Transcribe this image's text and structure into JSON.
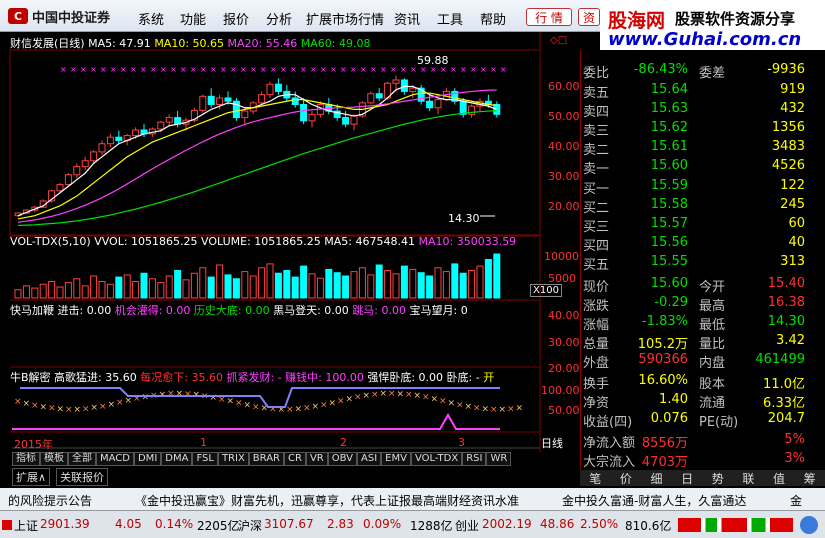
{
  "app": {
    "logo_text": "中国中投证券"
  },
  "menu": [
    "系统",
    "功能",
    "报价",
    "分析",
    "扩展市场行情",
    "资讯",
    "工具",
    "帮助"
  ],
  "quick_buttons": [
    "行 情",
    "资"
  ],
  "banner": {
    "site_cn": "股海网",
    "slogan": "股票软件资源分享",
    "url": "www.Guhai.com.cn"
  },
  "main_chart": {
    "header": {
      "name": "财信发展(日线)",
      "ma5": "MA5: 47.91",
      "ma10": "MA10: 50.65",
      "ma20": "MA20: 55.46",
      "ma60": "MA60: 49.08"
    },
    "high_label": "59.88",
    "low_label": "14.30",
    "y_ticks": [
      "60.00",
      "50.00",
      "40.00",
      "30.00",
      "20.00"
    ],
    "candles": [
      [
        17,
        18,
        16.5,
        17.8
      ],
      [
        17.8,
        19,
        17.5,
        18.7
      ],
      [
        18.7,
        20,
        18,
        19.6
      ],
      [
        19.6,
        22,
        19.3,
        21.5
      ],
      [
        21.5,
        25,
        21,
        24.6
      ],
      [
        24.6,
        27,
        24,
        26.5
      ],
      [
        26.5,
        30,
        26,
        29.5
      ],
      [
        29.5,
        33,
        28.5,
        32
      ],
      [
        32,
        35,
        31,
        33.8
      ],
      [
        33.8,
        37,
        33,
        36.5
      ],
      [
        36.5,
        40,
        35.5,
        39
      ],
      [
        39,
        42,
        38,
        41
      ],
      [
        41,
        43,
        39,
        40
      ],
      [
        40,
        42,
        38.5,
        41.5
      ],
      [
        41.5,
        44,
        40.5,
        43.2
      ],
      [
        43.2,
        45,
        41,
        42
      ],
      [
        42,
        44,
        41,
        43.5
      ],
      [
        43.5,
        46,
        42.5,
        45.6
      ],
      [
        45.6,
        48,
        44.5,
        47
      ],
      [
        47,
        49,
        44,
        45
      ],
      [
        45,
        47,
        43,
        46.2
      ],
      [
        46.2,
        50,
        45.5,
        49.2
      ],
      [
        49.2,
        54,
        48.5,
        53.5
      ],
      [
        53.5,
        56,
        50,
        51
      ],
      [
        51,
        54,
        49.5,
        53
      ],
      [
        53,
        55,
        51,
        52
      ],
      [
        52,
        53,
        46,
        47
      ],
      [
        47,
        50,
        45,
        49
      ],
      [
        49,
        52,
        48,
        51.5
      ],
      [
        51.5,
        55,
        51,
        54
      ],
      [
        54,
        58,
        53,
        57.2
      ],
      [
        57.2,
        59,
        54,
        55
      ],
      [
        55,
        57,
        52,
        53
      ],
      [
        53,
        55,
        50,
        51
      ],
      [
        51,
        53,
        45,
        46
      ],
      [
        46,
        49,
        44,
        48
      ],
      [
        48,
        52,
        47,
        51
      ],
      [
        51,
        53,
        48,
        49
      ],
      [
        49,
        51,
        46,
        47
      ],
      [
        47,
        49,
        44,
        45
      ],
      [
        45,
        48,
        43,
        47.5
      ],
      [
        47.5,
        52,
        47,
        51.5
      ],
      [
        51.5,
        55,
        51,
        54.3
      ],
      [
        54.3,
        56,
        52,
        53
      ],
      [
        53,
        58,
        52.5,
        57.5
      ],
      [
        57.5,
        59.88,
        55,
        58.5
      ],
      [
        58.5,
        59,
        54,
        55
      ],
      [
        55,
        57,
        53,
        56
      ],
      [
        56,
        57,
        51,
        52
      ],
      [
        52,
        54,
        49,
        50
      ],
      [
        50,
        53,
        48,
        52.5
      ],
      [
        52.5,
        56,
        52,
        55
      ],
      [
        55,
        56,
        51,
        52
      ],
      [
        52,
        53,
        47,
        48
      ],
      [
        48,
        51,
        47,
        50.5
      ],
      [
        50.5,
        53,
        49,
        52
      ],
      [
        52,
        54,
        50,
        51
      ],
      [
        51,
        52,
        47,
        48
      ]
    ],
    "ma5": [
      17,
      18,
      19,
      20,
      22,
      24,
      26,
      28,
      30,
      33,
      35,
      37,
      39,
      40,
      41,
      42,
      42.5,
      43,
      44.5,
      45,
      45.5,
      46.5,
      48,
      49.5,
      50.5,
      51.5,
      51,
      50,
      50,
      51,
      52,
      53.5,
      54,
      54,
      52.5,
      51,
      50,
      49,
      48.5,
      48,
      47.5,
      48,
      49.5,
      51,
      53,
      55.5,
      56.5,
      56.5,
      55.5,
      54,
      53,
      52.5,
      52.5,
      52,
      51.5,
      51,
      50.5,
      49.5
    ],
    "ma10": [
      16,
      16.5,
      17,
      18,
      19,
      20,
      21.5,
      23,
      25,
      27,
      29,
      31,
      33,
      35,
      36.5,
      38,
      39.5,
      40.5,
      41.5,
      42.5,
      43.5,
      44.5,
      45.5,
      46.5,
      47.5,
      48.5,
      49,
      49.5,
      50,
      50.5,
      51,
      51.5,
      52,
      52.5,
      52.5,
      52,
      51.5,
      51,
      50.5,
      50,
      49.5,
      49.5,
      50,
      50.5,
      51,
      52,
      53,
      54,
      54.5,
      54.5,
      54,
      53.5,
      53,
      52.5,
      52,
      51.5,
      51,
      50.7
    ],
    "ma20": [
      15,
      15.3,
      15.7,
      16.2,
      16.8,
      17.5,
      18.3,
      19.2,
      20.2,
      21.3,
      22.5,
      23.8,
      25.2,
      26.7,
      28.2,
      29.8,
      31.3,
      32.8,
      34.2,
      35.6,
      37,
      38.3,
      39.6,
      40.8,
      42,
      43,
      44,
      44.9,
      45.7,
      46.4,
      47,
      47.6,
      48.2,
      48.7,
      49.1,
      49.4,
      49.6,
      49.8,
      50,
      50.1,
      50.2,
      50.4,
      50.6,
      50.9,
      51.2,
      51.6,
      52,
      52.4,
      52.8,
      53.2,
      53.6,
      54,
      54.4,
      54.7,
      55,
      55.2,
      55.4,
      55.46
    ],
    "ma60": [
      14,
      14.1,
      14.2,
      14.4,
      14.6,
      14.8,
      15.1,
      15.4,
      15.8,
      16.2,
      16.7,
      17.2,
      17.8,
      18.4,
      19,
      19.7,
      20.4,
      21.1,
      21.9,
      22.7,
      23.5,
      24.3,
      25.2,
      26.1,
      27,
      27.9,
      28.8,
      29.7,
      30.6,
      31.5,
      32.4,
      33.3,
      34.2,
      35.1,
      36,
      36.8,
      37.6,
      38.4,
      39.2,
      40,
      40.8,
      41.5,
      42.2,
      42.9,
      43.6,
      44.3,
      45,
      45.6,
      46.2,
      46.7,
      47.2,
      47.6,
      48,
      48.3,
      48.6,
      48.8,
      49,
      49.08
    ]
  },
  "vol_panel": {
    "header": {
      "name": "VOL-TDX(5,10)",
      "vvol": "VVOL: 1051865.25",
      "volume": "VOLUME: 1051865.25",
      "ma5": "MA5: 467548.41",
      "ma10": "MA10: 350033.59"
    },
    "y_ticks": [
      "10000",
      "5000"
    ],
    "unit": "X100",
    "bars": [
      15,
      22,
      18,
      25,
      30,
      20,
      28,
      35,
      22,
      40,
      30,
      25,
      38,
      42,
      30,
      45,
      35,
      28,
      40,
      50,
      33,
      45,
      55,
      38,
      60,
      42,
      35,
      48,
      40,
      55,
      62,
      45,
      50,
      38,
      58,
      44,
      36,
      52,
      46,
      40,
      48,
      55,
      42,
      60,
      50,
      44,
      58,
      52,
      46,
      40,
      55,
      48,
      62,
      45,
      50,
      58,
      70,
      1051
    ]
  },
  "ind_panel": {
    "header": {
      "name": "快马加鞭",
      "chi": "进击: 0.00",
      "jihui": "机会灌得: 0.00",
      "lishi": "历史大底: 0.00",
      "heima": "黑马登天: 0.00",
      "tiaoma": "跳马: 0.00",
      "baoma": "宝马望月: 0"
    },
    "y_ticks": [
      "40.00",
      "30.00",
      "20.00"
    ]
  },
  "ind2_panel": {
    "header": {
      "name": "牛B解密",
      "gaoge": "高歌猛进: 35.60",
      "meikuang": "每况愈下: 35.60",
      "zhuajin": "抓紧发财: -",
      "zhuanqian": "赚钱中: 100.00",
      "qianghan": "强悍卧底: 0.00",
      "wodi": "卧底: -",
      "kai": "开"
    },
    "y_ticks": [
      "100.00",
      "50.00"
    ]
  },
  "time_axis": {
    "year": "2015年",
    "marks": [
      "1",
      "2",
      "3"
    ],
    "period": "日线"
  },
  "bottom_tabs": [
    "指标",
    "模板",
    "全部",
    "MACD",
    "DMI",
    "DMA",
    "FSL",
    "TRIX",
    "BRAR",
    "CR",
    "VR",
    "OBV",
    "ASI",
    "EMV",
    "VOL-TDX",
    "RSI",
    "WR"
  ],
  "bottom_tabs2": [
    "扩展∧",
    "关联报价"
  ],
  "quotes": {
    "weibi": {
      "k": "委比",
      "v": "-86.43%",
      "k2": "委差",
      "v2": "-9936"
    },
    "sell": [
      {
        "k": "卖五",
        "p": "15.64",
        "v": "919"
      },
      {
        "k": "卖四",
        "p": "15.63",
        "v": "432"
      },
      {
        "k": "卖三",
        "p": "15.62",
        "v": "1356"
      },
      {
        "k": "卖二",
        "p": "15.61",
        "v": "3483"
      },
      {
        "k": "卖一",
        "p": "15.60",
        "v": "4526"
      }
    ],
    "buy": [
      {
        "k": "买一",
        "p": "15.59",
        "v": "122"
      },
      {
        "k": "买二",
        "p": "15.58",
        "v": "245"
      },
      {
        "k": "买三",
        "p": "15.57",
        "v": "60"
      },
      {
        "k": "买四",
        "p": "15.56",
        "v": "40"
      },
      {
        "k": "买五",
        "p": "15.55",
        "v": "313"
      }
    ],
    "stats": [
      {
        "k": "现价",
        "v": "15.60",
        "k2": "今开",
        "v2": "15.40"
      },
      {
        "k": "涨跌",
        "v": "-0.29",
        "k2": "最高",
        "v2": "16.38"
      },
      {
        "k": "涨幅",
        "v": "-1.83%",
        "k2": "最低",
        "v2": "14.30"
      },
      {
        "k": "总量",
        "v": "105.2万",
        "k2": "量比",
        "v2": "3.42"
      },
      {
        "k": "外盘",
        "v": "590366",
        "k2": "内盘",
        "v2": "461499"
      },
      {
        "k": "换手",
        "v": "16.60%",
        "k2": "股本",
        "v2": "11.0亿"
      },
      {
        "k": "净资",
        "v": "1.40",
        "k2": "流通",
        "v2": "6.33亿"
      },
      {
        "k": "收益(四)",
        "v": "0.076",
        "k2": "PE(动)",
        "v2": "204.7"
      },
      {
        "k": "净流入额",
        "v": "8556万",
        "v2": "5%"
      },
      {
        "k": "大宗流入",
        "v": "4703万",
        "v2": "3%"
      }
    ]
  },
  "right_tabs": [
    "笔",
    "价",
    "细",
    "日",
    "势",
    "联",
    "值",
    "筹"
  ],
  "ticker": {
    "left": "的风险提示公告",
    "mid": "《金中投迅赢宝》财富先机，迅赢尊享，代表上证报最高端财经资讯水准",
    "right": "金中投久富通-财富人生，久富通达",
    "end": "金"
  },
  "status": {
    "sh_name": "上证",
    "sh_val": "2901.39",
    "sh_chg": "4.05",
    "sh_pct": "0.14%",
    "sh_amt": "2205亿",
    "sz_name": "沪深",
    "sz_val": "3107.67",
    "sz_chg": "2.83",
    "sz_pct": "0.09%",
    "sz_amt": "1288亿",
    "cy_name": "创业",
    "cy_val": "2002.19",
    "cy_chg": "48.86",
    "cy_pct": "2.50%",
    "cy_amt": "810.6亿"
  }
}
